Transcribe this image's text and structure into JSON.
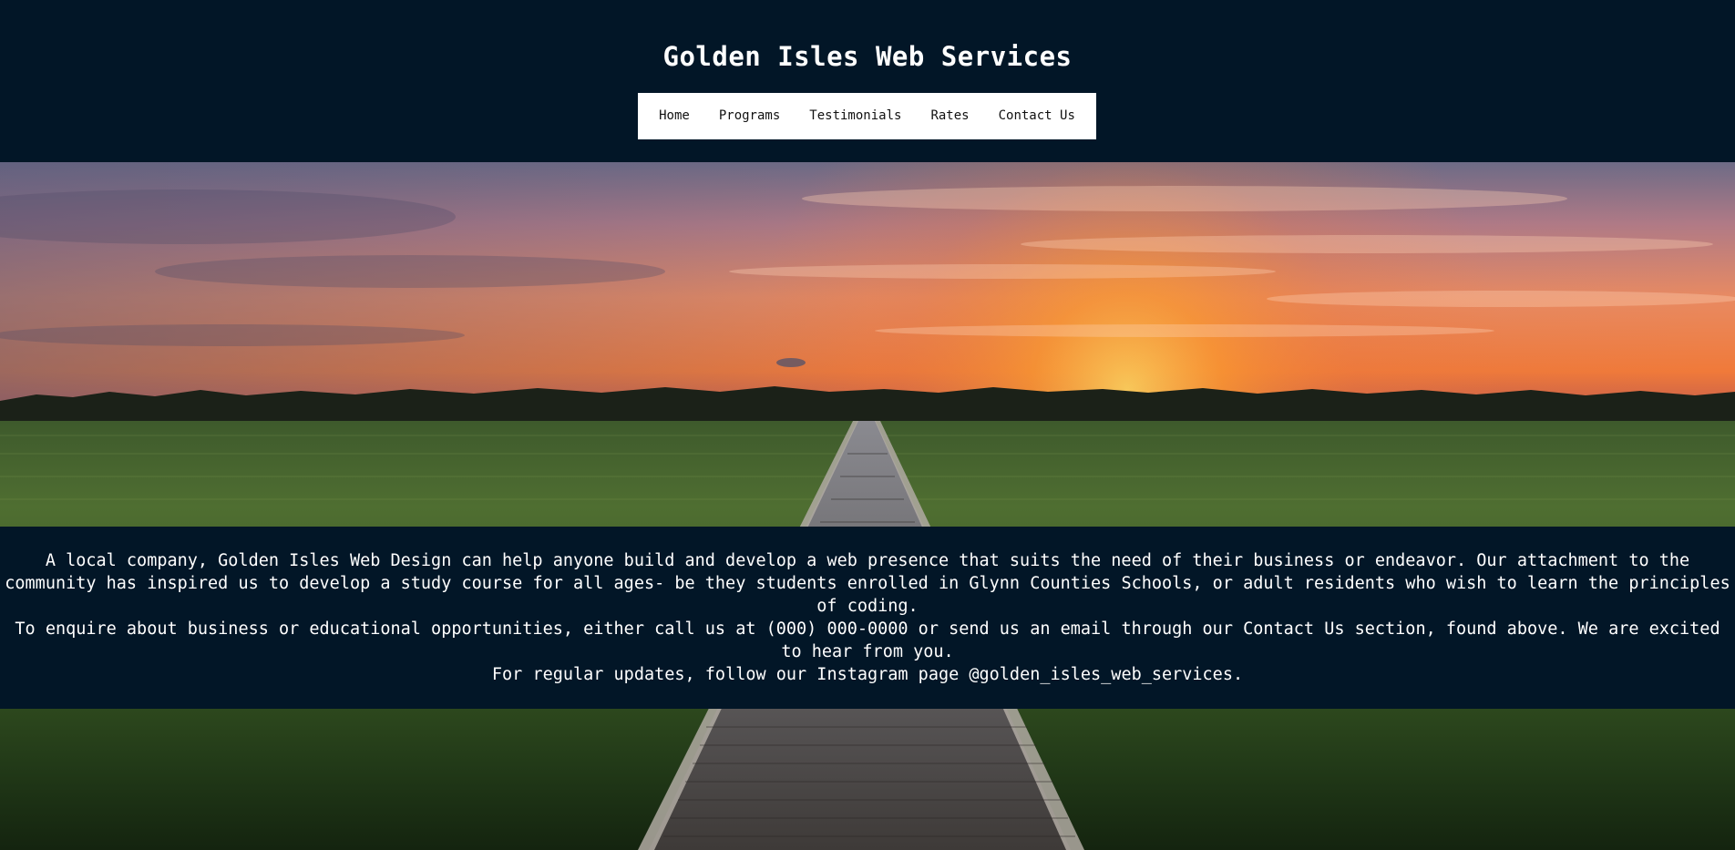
{
  "header": {
    "title": "Golden Isles Web Services"
  },
  "nav": {
    "items": [
      {
        "label": "Home"
      },
      {
        "label": "Programs"
      },
      {
        "label": "Testimonials"
      },
      {
        "label": "Rates"
      },
      {
        "label": "Contact Us"
      }
    ]
  },
  "intro": {
    "paragraph_1": "A local company, Golden Isles Web Design can help anyone build and develop a web presence that suits the need of their business or endeavor. Our attachment to the community has inspired us to develop a study course for all ages- be they students enrolled in Glynn Counties Schools, or adult residents who wish to learn the principles of coding.",
    "paragraph_2": "To enquire about business or educational opportunities, either call us at (000) 000-0000 or send us an email through our Contact Us section, found above. We are excited to hear from you.",
    "paragraph_3": "For regular updates, follow our Instagram page @golden_isles_web_services."
  },
  "colors": {
    "header_bg": "#021627",
    "nav_bg": "#ffffff",
    "text_light": "#ffffff",
    "text_dark": "#111111"
  }
}
